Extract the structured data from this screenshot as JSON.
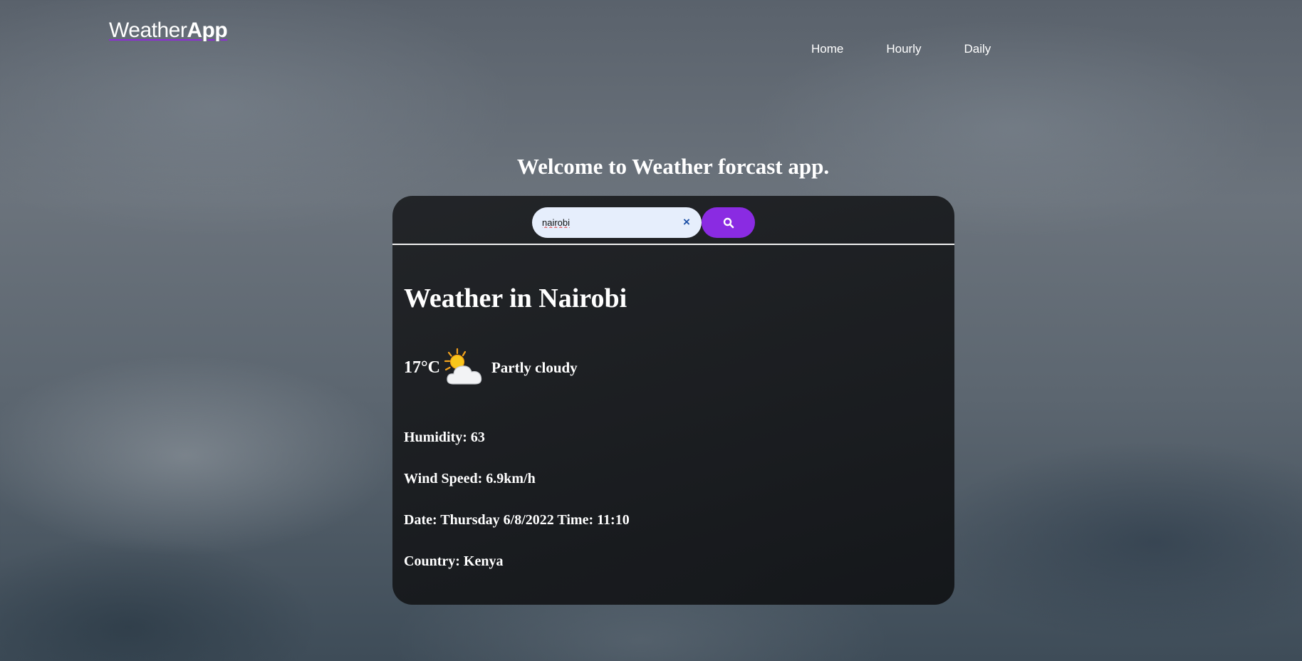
{
  "logo": {
    "part1": "Weather",
    "part2": "App"
  },
  "nav": [
    {
      "label": "Home"
    },
    {
      "label": "Hourly"
    },
    {
      "label": "Daily"
    }
  ],
  "welcome": "Welcome to Weather forcast app.",
  "search": {
    "value": "nairobi",
    "clear_label": "×",
    "button_icon": "search-icon"
  },
  "weather": {
    "title": "Weather in Nairobi",
    "temp": "17°C",
    "icon": "partly-cloudy-icon",
    "description": "Partly cloudy",
    "humidity": "Humidity: 63",
    "wind": "Wind Speed: 6.9km/h",
    "date": "Date: Thursday 6/8/2022 Time: 11:10",
    "country": "Country: Kenya"
  },
  "colors": {
    "accent": "#8a2be2",
    "search_field": "#e6eefc",
    "card": "#1c1e21"
  }
}
